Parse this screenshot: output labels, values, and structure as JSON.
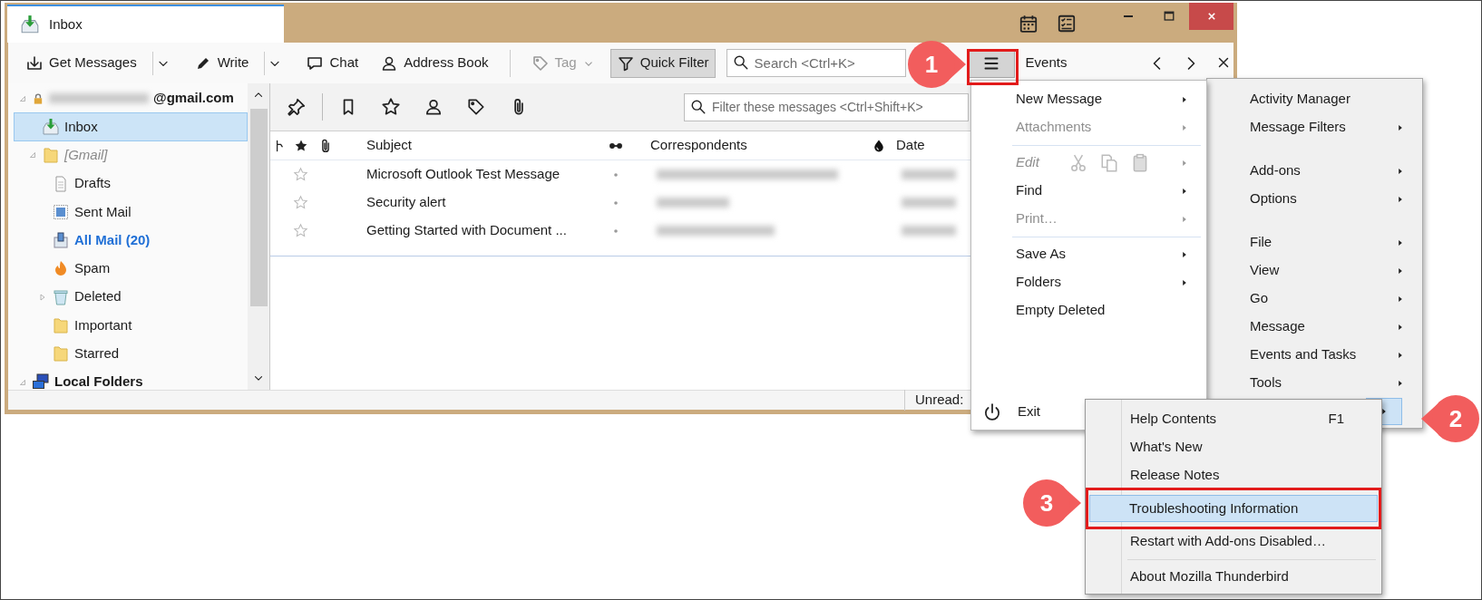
{
  "window": {
    "tab": {
      "title": "Inbox",
      "selected": true
    }
  },
  "toolbar": {
    "buttons": [
      {
        "label": "Get Messages",
        "kind": "split",
        "disabled": false,
        "pressed": false
      },
      {
        "label": "Write",
        "kind": "split",
        "disabled": false,
        "pressed": false
      },
      {
        "label": "Chat",
        "kind": "plain",
        "disabled": false,
        "pressed": false
      },
      {
        "label": "Address Book",
        "kind": "plain",
        "disabled": false,
        "pressed": false
      },
      {
        "label": "Tag",
        "kind": "dropdown",
        "disabled": true,
        "pressed": false
      },
      {
        "label": "Quick Filter",
        "kind": "plain",
        "disabled": false,
        "pressed": true
      }
    ],
    "search": {
      "placeholder": "Search <Ctrl+K>"
    },
    "menu_button": {
      "pressed": true
    }
  },
  "today_pane": {
    "title": "Events"
  },
  "folder_pane": {
    "folders": [
      {
        "label": "@gmail.com",
        "kind": "account",
        "expanded": true,
        "selected": false,
        "unread": false,
        "children": [
          {
            "label": "Inbox",
            "kind": "inbox",
            "selected": true,
            "unread": false
          },
          {
            "label": "[Gmail]",
            "kind": "virtual",
            "expanded": true,
            "selected": false,
            "unread": false,
            "children": [
              {
                "label": "Drafts",
                "kind": "drafts",
                "selected": false,
                "unread": false
              },
              {
                "label": "Sent Mail",
                "kind": "sent",
                "selected": false,
                "unread": false
              },
              {
                "label": "All Mail (20)",
                "kind": "archive",
                "selected": false,
                "unread": true
              },
              {
                "label": "Spam",
                "kind": "spam",
                "selected": false,
                "unread": false
              },
              {
                "label": "Deleted",
                "kind": "trash",
                "expanded": false,
                "selected": false,
                "unread": false
              },
              {
                "label": "Important",
                "kind": "folder",
                "selected": false,
                "unread": false
              },
              {
                "label": "Starred",
                "kind": "folder",
                "selected": false,
                "unread": false
              }
            ]
          }
        ]
      },
      {
        "label": "Local Folders",
        "kind": "local",
        "expanded": true,
        "selected": false,
        "unread": false
      }
    ]
  },
  "quick_filter": {
    "placeholder": "Filter these messages <Ctrl+Shift+K>"
  },
  "message_list": {
    "columns": [
      "Subject",
      "Correspondents",
      "Date"
    ],
    "rows": [
      {
        "subject": "Microsoft Outlook Test Message",
        "starred": false
      },
      {
        "subject": "Security alert",
        "starred": false
      },
      {
        "subject": "Getting Started with Document ...",
        "starred": false
      }
    ]
  },
  "status_bar": {
    "unread_label": "Unread:"
  },
  "app_menu": {
    "items": [
      {
        "label": "New Message",
        "kind": "command",
        "submenu": true,
        "disabled": false
      },
      {
        "label": "Attachments",
        "kind": "command",
        "submenu": true,
        "disabled": true
      },
      {
        "kind": "separator"
      },
      {
        "label": "Edit",
        "kind": "edit",
        "submenu": true,
        "disabled": true
      },
      {
        "label": "Find",
        "kind": "command",
        "submenu": true,
        "disabled": false
      },
      {
        "label": "Print…",
        "kind": "command",
        "submenu": true,
        "disabled": true
      },
      {
        "kind": "separator"
      },
      {
        "label": "Save As",
        "kind": "command",
        "submenu": true,
        "disabled": false
      },
      {
        "label": "Folders",
        "kind": "command",
        "submenu": true,
        "disabled": false
      },
      {
        "label": "Empty Deleted",
        "kind": "command",
        "submenu": false,
        "disabled": false
      },
      {
        "label": "Exit",
        "kind": "exit",
        "submenu": false,
        "disabled": false
      }
    ]
  },
  "app_submenu": {
    "items": [
      {
        "label": "Activity Manager",
        "kind": "command",
        "submenu": false,
        "selected": false
      },
      {
        "label": "Message Filters",
        "kind": "command",
        "submenu": true,
        "selected": false
      },
      {
        "kind": "gap"
      },
      {
        "label": "Add-ons",
        "kind": "command",
        "submenu": true,
        "selected": false
      },
      {
        "label": "Options",
        "kind": "command",
        "submenu": true,
        "selected": false
      },
      {
        "kind": "gap"
      },
      {
        "label": "File",
        "kind": "command",
        "submenu": true,
        "selected": false
      },
      {
        "label": "View",
        "kind": "command",
        "submenu": true,
        "selected": false
      },
      {
        "label": "Go",
        "kind": "command",
        "submenu": true,
        "selected": false
      },
      {
        "label": "Message",
        "kind": "command",
        "submenu": true,
        "selected": false
      },
      {
        "label": "Events and Tasks",
        "kind": "command",
        "submenu": true,
        "selected": false
      },
      {
        "label": "Tools",
        "kind": "command",
        "submenu": true,
        "selected": false
      },
      {
        "kind": "covered",
        "submenu": true,
        "selected": true
      }
    ]
  },
  "help_menu": {
    "items": [
      {
        "label": "Help Contents",
        "kind": "command",
        "shortcut": "F1",
        "selected": false
      },
      {
        "label": "What's New",
        "kind": "command",
        "selected": false
      },
      {
        "label": "Release Notes",
        "kind": "command",
        "selected": false
      },
      {
        "label": "Troubleshooting Information",
        "kind": "command",
        "selected": true
      },
      {
        "label": "Restart with Add-ons Disabled…",
        "kind": "command",
        "selected": false
      },
      {
        "kind": "separator"
      },
      {
        "label": "About Mozilla Thunderbird",
        "kind": "command",
        "selected": false
      }
    ]
  },
  "callouts": [
    {
      "number": "1"
    },
    {
      "number": "2"
    },
    {
      "number": "3"
    }
  ]
}
